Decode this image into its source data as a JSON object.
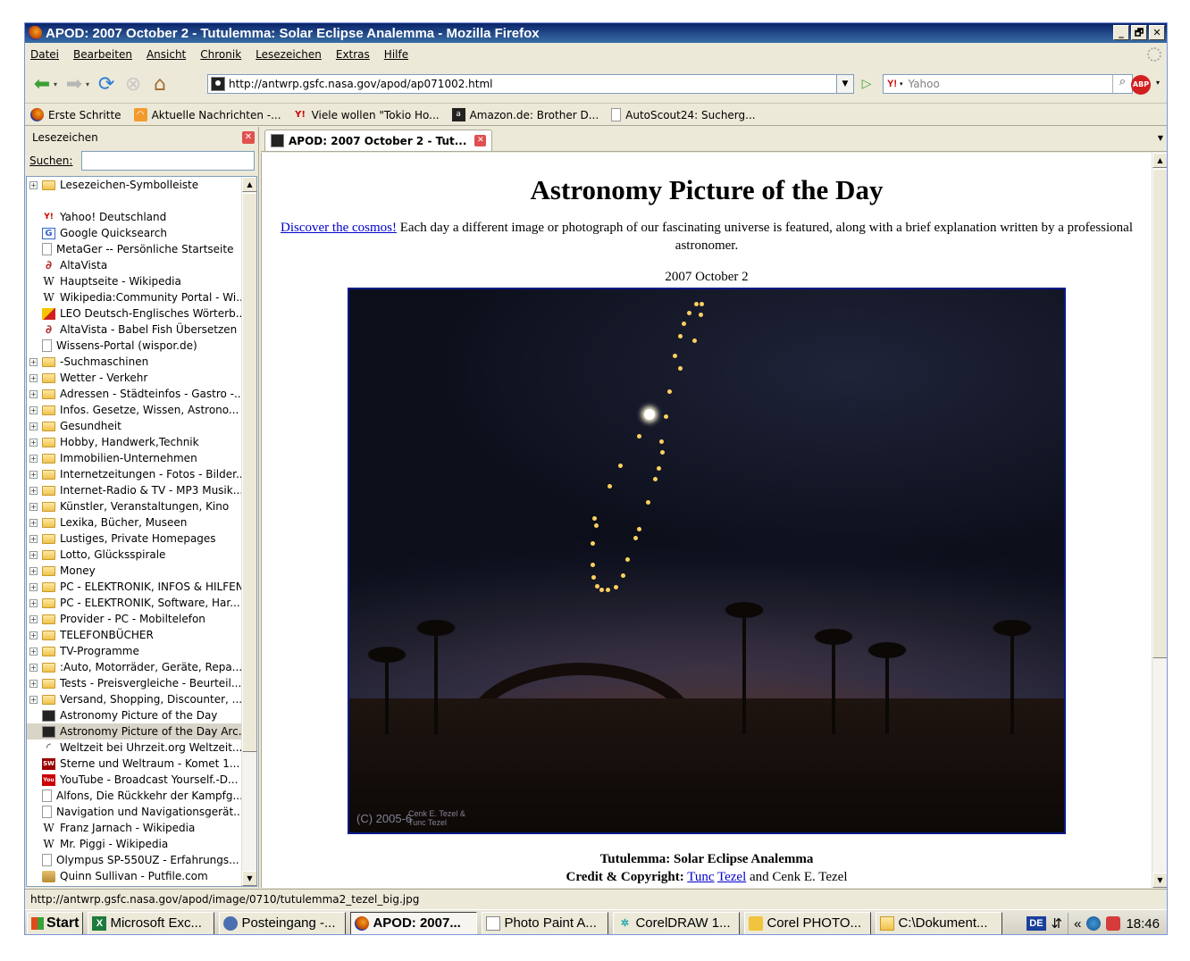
{
  "window": {
    "title": "APOD: 2007 October 2 - Tutulemma: Solar Eclipse Analemma - Mozilla Firefox",
    "buttons": {
      "minimize": "_",
      "maximize": "🗗",
      "close": "✕"
    }
  },
  "menu": [
    "Datei",
    "Bearbeiten",
    "Ansicht",
    "Chronik",
    "Lesezeichen",
    "Extras",
    "Hilfe"
  ],
  "navbar": {
    "url": "http://antwrp.gsfc.nasa.gov/apod/ap071002.html",
    "search_engine": "Y!",
    "search_placeholder": "Yahoo",
    "abp_label": "ABP"
  },
  "bookmarks_toolbar": [
    {
      "label": "Erste Schritte",
      "icon": "firefox-icon"
    },
    {
      "label": "Aktuelle Nachrichten -...",
      "icon": "rss-icon"
    },
    {
      "label": "Viele wollen \"Tokio Ho...",
      "icon": "yahoo-icon"
    },
    {
      "label": "Amazon.de: Brother D...",
      "icon": "amazon-icon"
    },
    {
      "label": "AutoScout24: Sucherg...",
      "icon": "page-icon"
    }
  ],
  "sidebar": {
    "title": "Lesezeichen",
    "search_label": "Suchen:",
    "search_value": "",
    "items": [
      {
        "label": "Lesezeichen-Symbolleiste",
        "type": "folder",
        "expand": true
      },
      {
        "label": "",
        "type": "blank"
      },
      {
        "label": "Yahoo! Deutschland",
        "type": "y"
      },
      {
        "label": "Google Quicksearch",
        "type": "g"
      },
      {
        "label": "MetaGer -- Persönliche Startseite",
        "type": "page"
      },
      {
        "label": "AltaVista",
        "type": "av"
      },
      {
        "label": "Hauptseite - Wikipedia",
        "type": "w"
      },
      {
        "label": "Wikipedia:Community Portal - Wi...",
        "type": "w"
      },
      {
        "label": "LEO Deutsch-Englisches Wörterb...",
        "type": "leo"
      },
      {
        "label": "AltaVista - Babel Fish Übersetzen",
        "type": "av"
      },
      {
        "label": "Wissens-Portal (wispor.de)",
        "type": "page"
      },
      {
        "label": "-Suchmaschinen",
        "type": "folder",
        "expand": true
      },
      {
        "label": "Wetter - Verkehr",
        "type": "folder",
        "expand": true
      },
      {
        "label": "Adressen - Städteinfos - Gastro -...",
        "type": "folder",
        "expand": true
      },
      {
        "label": "Infos. Gesetze, Wissen, Astrono...",
        "type": "folder",
        "expand": true
      },
      {
        "label": "Gesundheit",
        "type": "folder",
        "expand": true
      },
      {
        "label": "Hobby, Handwerk,Technik",
        "type": "folder",
        "expand": true
      },
      {
        "label": "Immobilien-Unternehmen",
        "type": "folder",
        "expand": true
      },
      {
        "label": "Internetzeitungen - Fotos - Bilder...",
        "type": "folder",
        "expand": true
      },
      {
        "label": "Internet-Radio & TV - MP3 Musik...",
        "type": "folder",
        "expand": true
      },
      {
        "label": "Künstler, Veranstaltungen, Kino",
        "type": "folder",
        "expand": true
      },
      {
        "label": "Lexika, Bücher, Museen",
        "type": "folder",
        "expand": true
      },
      {
        "label": "Lustiges, Private Homepages",
        "type": "folder",
        "expand": true
      },
      {
        "label": "Lotto, Glücksspirale",
        "type": "folder",
        "expand": true
      },
      {
        "label": "Money",
        "type": "folder",
        "expand": true
      },
      {
        "label": "PC - ELEKTRONIK, INFOS & HILFEN",
        "type": "folder",
        "expand": true
      },
      {
        "label": "PC - ELEKTRONIK, Software, Har...",
        "type": "folder",
        "expand": true
      },
      {
        "label": "Provider - PC - Mobiltelefon",
        "type": "folder",
        "expand": true
      },
      {
        "label": "TELEFONBÜCHER",
        "type": "folder",
        "expand": true
      },
      {
        "label": "TV-Programme",
        "type": "folder",
        "expand": true
      },
      {
        "label": ":Auto, Motorräder, Geräte, Repa...",
        "type": "folder",
        "expand": true
      },
      {
        "label": "Tests - Preisvergleiche - Beurteil...",
        "type": "folder",
        "expand": true
      },
      {
        "label": "Versand, Shopping, Discounter, ...",
        "type": "folder",
        "expand": true
      },
      {
        "label": "Astronomy Picture of the Day",
        "type": "apod"
      },
      {
        "label": "Astronomy Picture of the Day Arc...",
        "type": "apod",
        "selected": true
      },
      {
        "label": "Weltzeit bei Uhrzeit.org Weltzeit...",
        "type": "clock"
      },
      {
        "label": "Sterne und Weltraum - Komet 1...",
        "type": "sw"
      },
      {
        "label": "YouTube - Broadcast Yourself.-D...",
        "type": "yt"
      },
      {
        "label": "Alfons, Die Rückkehr der Kampfg...",
        "type": "page"
      },
      {
        "label": "Navigation und Navigationsgerät...",
        "type": "page"
      },
      {
        "label": "Franz Jarnach - Wikipedia",
        "type": "w"
      },
      {
        "label": "Mr. Piggi - Wikipedia",
        "type": "w"
      },
      {
        "label": "Olympus SP-550UZ - Erfahrungs...",
        "type": "page"
      },
      {
        "label": "Quinn Sullivan - Putfile.com",
        "type": "pf"
      }
    ]
  },
  "tab": {
    "label": "APOD: 2007 October 2 - Tut..."
  },
  "apod": {
    "heading": "Astronomy Picture of the Day",
    "intro_link": "Discover the cosmos!",
    "intro_text": " Each day a different image or photograph of our fascinating universe is featured, along with a brief explanation written by a professional astronomer.",
    "date": "2007 October 2",
    "image_credit_main": "(C) 2005-6",
    "image_credit_names": "Cenk E. Tezel & Tunc Tezel",
    "caption_title": "Tutulemma: Solar Eclipse Analemma",
    "credit_label": "Credit & Copyright:",
    "credit_link1": "Tunc",
    "credit_link2": "Tezel",
    "credit_rest": " and Cenk E. Tezel"
  },
  "statusbar": {
    "text": "http://antwrp.gsfc.nasa.gov/apod/image/0710/tutulemma2_tezel_big.jpg"
  },
  "taskbar": {
    "start": "Start",
    "buttons": [
      {
        "label": "Microsoft Exc...",
        "icon": "excel-icon",
        "active": false
      },
      {
        "label": "Posteingang -...",
        "icon": "outlook-icon",
        "active": false
      },
      {
        "label": "APOD: 2007...",
        "icon": "firefox-icon",
        "active": true
      },
      {
        "label": "Photo Paint A...",
        "icon": "photopaint-icon",
        "active": false
      },
      {
        "label": "CorelDRAW 1...",
        "icon": "coreldraw-icon",
        "active": false
      },
      {
        "label": "Corel PHOTO...",
        "icon": "corel-photo-icon",
        "active": false
      },
      {
        "label": "C:\\Dokument...",
        "icon": "folder-icon",
        "active": false
      }
    ],
    "lang": "DE",
    "clock": "18:46",
    "chevron": "«"
  }
}
